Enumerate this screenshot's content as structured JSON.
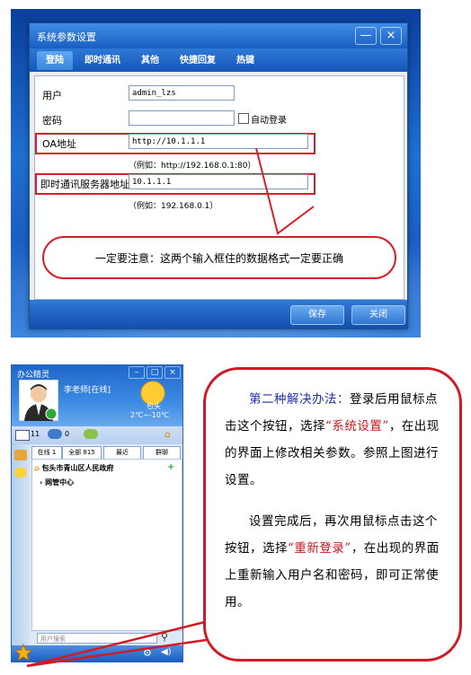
{
  "dialog": {
    "title": "系统参数设置",
    "min_glyph": "—",
    "close_glyph": "×",
    "tabs": [
      {
        "label": "登陆"
      },
      {
        "label": "即时通讯"
      },
      {
        "label": "其他"
      },
      {
        "label": "快捷回复"
      },
      {
        "label": "热键"
      }
    ],
    "fields": {
      "user_label": "用户",
      "user_value": "admin_lzs",
      "password_label": "密码",
      "password_value": "",
      "auto_login_label": "自动登录",
      "oa_label": "OA地址",
      "oa_value": "http://10.1.1.1",
      "oa_hint": "（例如：http://192.168.0.1:80）",
      "im_server_label": "即时通讯服务器地址",
      "im_server_value": "10.1.1.1",
      "im_server_hint": "（例如：192.168.0.1）"
    },
    "warning": "一定要注意：这两个输入框住的数据格式一定要正确",
    "save_button": "保存",
    "close_button": "关闭"
  },
  "im_client": {
    "title": "办公精灵",
    "user_name": "李老师[在线]",
    "city": "包头",
    "temperature": "2℃~-10℃",
    "mail_count": "11",
    "msg_count": "0",
    "tabs": [
      "在线 1",
      "全部 815",
      "最近",
      "群聊"
    ],
    "tree": [
      {
        "label": "包头市青山区人民政府"
      },
      {
        "label": "网管中心"
      }
    ],
    "search_placeholder": "用户搜索"
  },
  "callout": {
    "p1_prefix": "第二种解决办法：",
    "p1_a": "登录后用鼠标点击这个按钮，选择",
    "p1_menu": "“系统设置”",
    "p1_b": "，在出现的界面上修改相关参数。参照上图进行设置。",
    "p2_a": "设置完成后，再次用鼠标点击这个按钮，选择",
    "p2_menu": "“重新登录”",
    "p2_b": "，在出现的界面上重新输入用户名和密码，即可正常使用。"
  },
  "colors": {
    "callout_border": "#d11b24",
    "highlight_red": "#d0161f",
    "highlight_blue": "#1e2fa8",
    "dialog_blue": "#1a5fc3"
  }
}
